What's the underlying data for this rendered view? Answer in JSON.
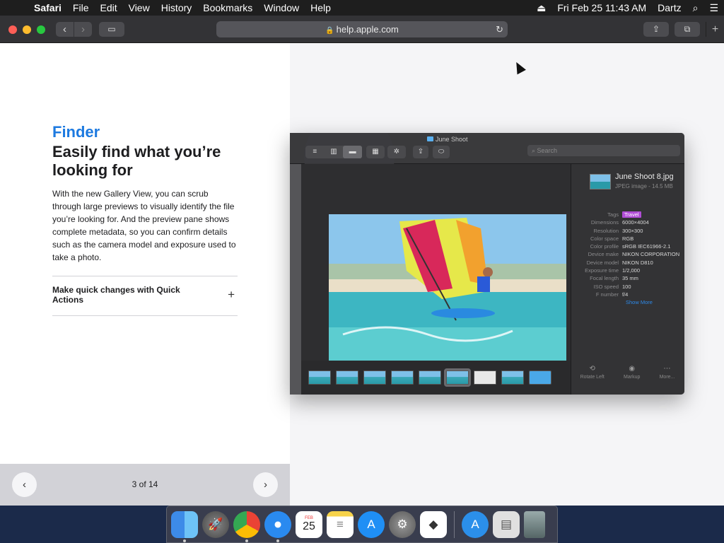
{
  "menubar": {
    "apple_icon": "apple-logo",
    "app_name": "Safari",
    "items": [
      "File",
      "Edit",
      "View",
      "History",
      "Bookmarks",
      "Window",
      "Help"
    ],
    "datetime": "Fri Feb 25  11:43 AM",
    "user": "Dartz"
  },
  "toolbar": {
    "url": "help.apple.com"
  },
  "article": {
    "eyebrow": "Finder",
    "headline": "Easily find what you’re looking for",
    "body": "With the new Gallery View, you can scrub through large previews to visually identify the file you’re looking for. And the preview pane shows complete metadata, so you can confirm details such as the camera model and exposure used to take a photo.",
    "accordion_label": "Make quick changes with Quick Actions",
    "accordion_icon": "+"
  },
  "pager": {
    "count": "3 of 14"
  },
  "finder": {
    "window_title": "June Shoot",
    "search_placeholder": "Search",
    "file_name": "June Shoot 8.jpg",
    "file_sub": "JPEG image - 14.5 MB",
    "metadata": [
      {
        "key": "Tags",
        "value": "Travel",
        "tag": true
      },
      {
        "key": "Dimensions",
        "value": "6000×4004"
      },
      {
        "key": "Resolution",
        "value": "300×300"
      },
      {
        "key": "Color space",
        "value": "RGB"
      },
      {
        "key": "Color profile",
        "value": "sRGB IEC61966-2.1"
      },
      {
        "key": "Device make",
        "value": "NIKON CORPORATION"
      },
      {
        "key": "Device model",
        "value": "NIKON D810"
      },
      {
        "key": "Exposure time",
        "value": "1/2,000"
      },
      {
        "key": "Focal length",
        "value": "35 mm"
      },
      {
        "key": "ISO speed",
        "value": "100"
      },
      {
        "key": "F number",
        "value": "f/4"
      }
    ],
    "show_more": "Show More",
    "actions": [
      "Rotate Left",
      "Markup",
      "More..."
    ]
  },
  "dock": {
    "calendar_month": "FEB",
    "calendar_day": "25"
  }
}
